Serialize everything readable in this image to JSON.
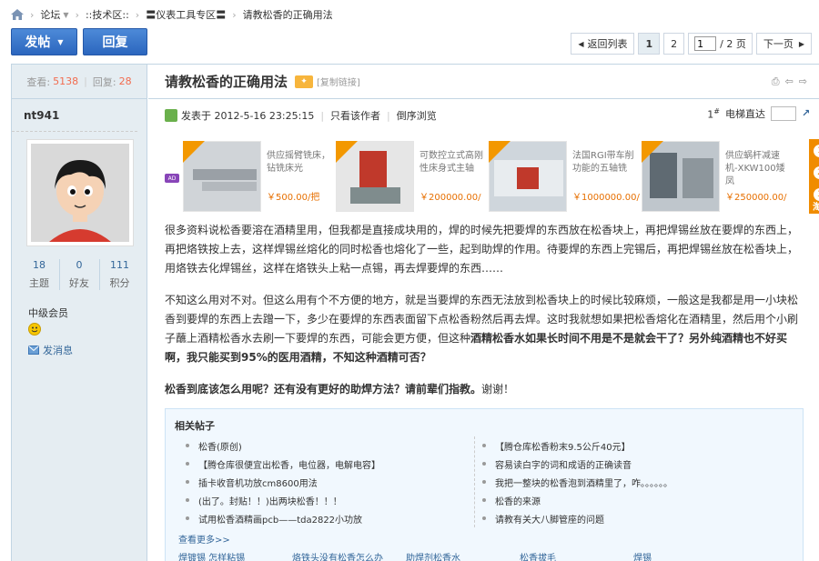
{
  "breadcrumb": {
    "items": [
      "论坛",
      "::技术区::",
      "〓仪表工具专区〓",
      "请教松香的正确用法"
    ]
  },
  "toolbar": {
    "post_label": "发帖",
    "reply_label": "回复"
  },
  "pager": {
    "back_label": "返回列表",
    "pages": [
      "1",
      "2"
    ],
    "current_page": "1",
    "total_label": "/ 2 页",
    "next_label": "下一页"
  },
  "sidebar": {
    "views_label": "查看:",
    "views": "5138",
    "replies_label": "回复:",
    "replies": "28",
    "username": "nt941",
    "stats": [
      {
        "value": "18",
        "label": "主题"
      },
      {
        "value": "0",
        "label": "好友"
      },
      {
        "value": "111",
        "label": "积分"
      }
    ],
    "rank": "中级会员",
    "message_label": "发消息"
  },
  "post": {
    "title": "请教松香的正确用法",
    "copy_link": "[复制链接]",
    "meta_prefix": "发表于",
    "date": "2012-5-16 23:25:15",
    "author_only": "只看该作者",
    "reverse": "倒序浏览",
    "floor": "1",
    "floor_suffix": "#",
    "elevator_label": "电梯直达",
    "paragraphs": [
      "很多资料说松香要溶在酒精里用，但我都是直接成块用的，焊的时候先把要焊的东西放在松香块上，再把焊锡丝放在要焊的东西上，再把烙铁按上去，这样焊锡丝熔化的同时松香也熔化了一些，起到助焊的作用。待要焊的东西上完锡后，再把焊锡丝放在松香块上，用烙铁去化焊锡丝，这样在烙铁头上粘一点锡，再去焊要焊的东西……",
      "不知这么用对不对。但这么用有个不方便的地方，就是当要焊的东西无法放到松香块上的时候比较麻烦，一般这是我都是用一小块松香到要焊的东西上去蹭一下，多少在要焊的东西表面留下点松香粉然后再去焊。这时我就想如果把松香熔化在酒精里，然后用个小刷子蘸上酒精松香水去刷一下要焊的东西，可能会更方便，但这种",
      "酒精松香水如果长时间不用是不是就会干了？另外纯酒精也不好买啊，我只能买到95%的医用酒精，不知这种酒精可否？",
      "松香到底该怎么用呢？还有没有更好的助焊方法？请前辈们指教。",
      "谢谢！"
    ]
  },
  "ads": [
    {
      "text": "供应摇臂铣床，钻铣床光",
      "price": "￥500.00/把"
    },
    {
      "text": "可数控立式高刚性床身式主轴",
      "price": "￥200000.00/"
    },
    {
      "text": "法国RGI带车削功能的五轴铣",
      "price": "￥1000000.00/"
    },
    {
      "text": "供应蜗杆减速机-XKW100矮凤",
      "price": "￥250000.00/"
    }
  ],
  "ad_side": [
    "1",
    "2",
    "3"
  ],
  "ad_side_label": "淘",
  "ad_tag": "AD",
  "related": {
    "title": "相关帖子",
    "left": [
      "松香(原创)",
      "【腾仓库很便宜出松香，电位器，电解电容】",
      "插卡收音机功放cm8600用法",
      "(出了。封贴！！)出两块松香！！！",
      "试用松香酒精画pcb——tda2822小功放"
    ],
    "right": [
      "【腾仓库松香粉末9.5公斤40元】",
      "容易读白字的词和成语的正确读音",
      "我把一整块的松香泡到酒精里了，咋。。。。。。",
      "松香的来源",
      "请教有关大八脚管座的问题"
    ],
    "more": "查看更多>>",
    "tags": [
      "焊镀锡 怎样粘锡",
      "烙铁头没有松香怎么办",
      "助焊剂松香水",
      "松香拔毛",
      "焊锡"
    ]
  },
  "colors": {
    "accent_blue": "#2b66be",
    "sidebar_bg": "#e5edf2",
    "link": "#336699",
    "highlight": "#f26c4f",
    "ad_orange": "#f08c00"
  }
}
